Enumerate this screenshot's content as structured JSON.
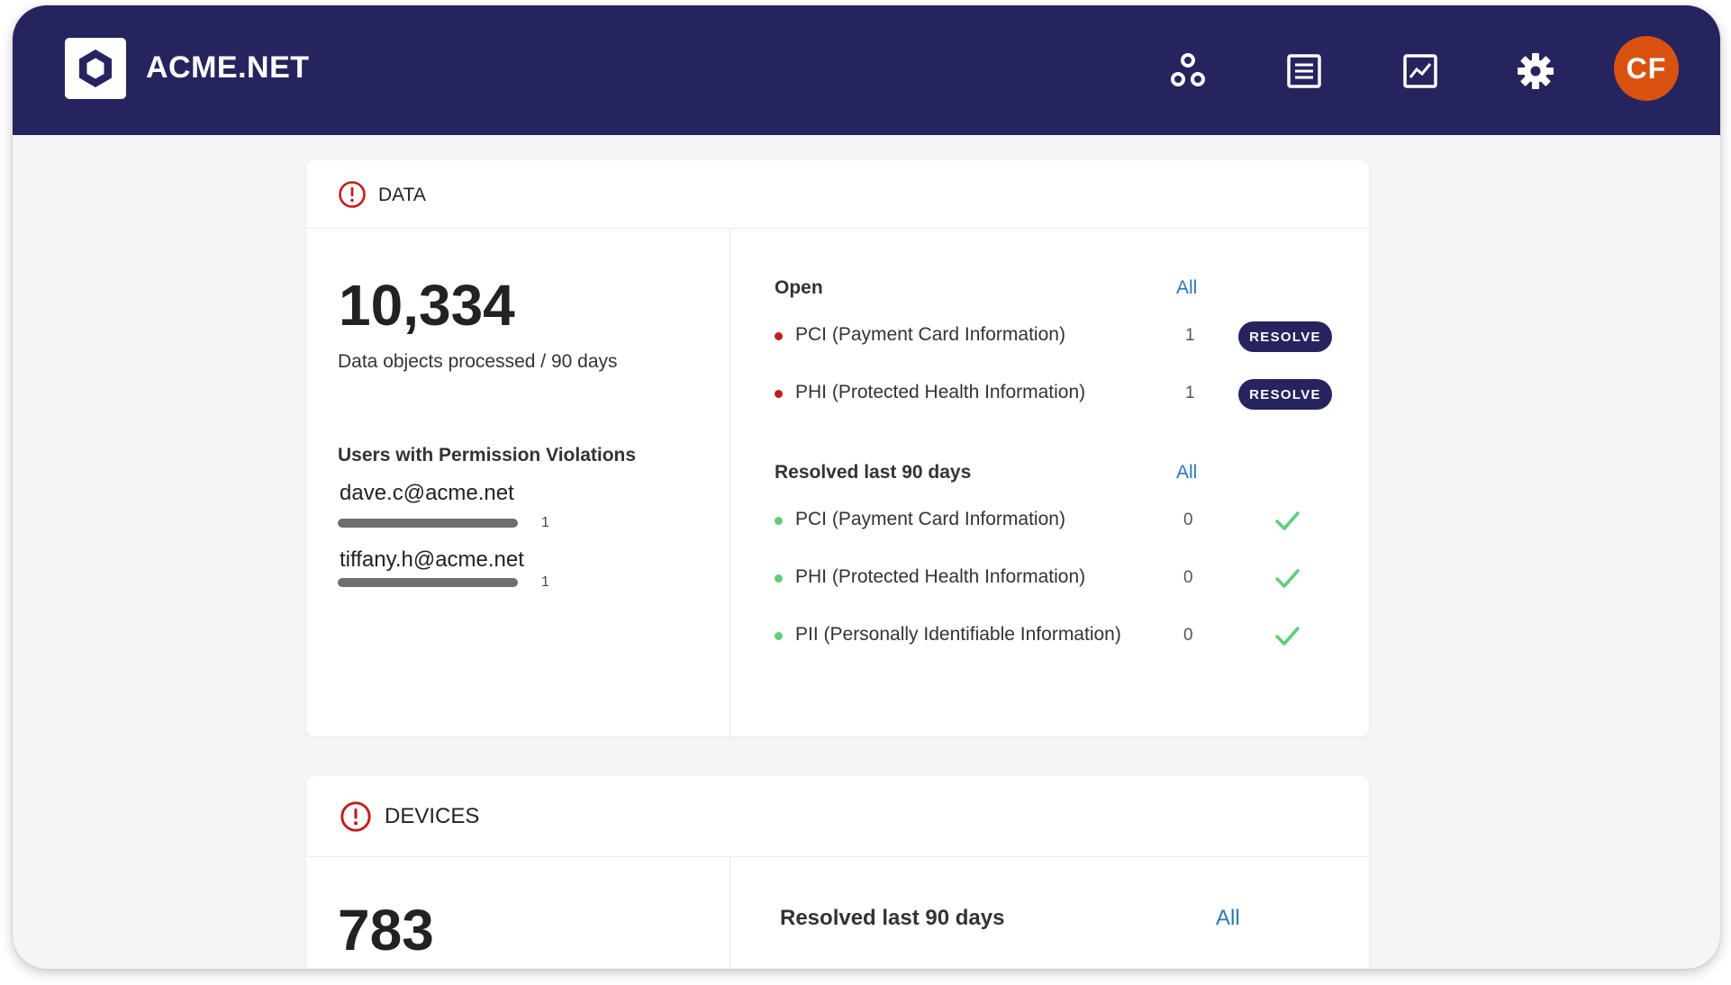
{
  "header": {
    "brand": "ACME.NET",
    "icons": [
      "network-icon",
      "list-icon",
      "chart-icon",
      "gear-icon"
    ],
    "avatar_initials": "CF",
    "colors": {
      "bar": "#25245e",
      "avatar": "#d9520f"
    }
  },
  "data_card": {
    "title": "DATA",
    "big_number": "10,334",
    "big_label": "Data objects processed / 90 days",
    "users_title": "Users with Permission Violations",
    "users": [
      {
        "email": "dave.c@acme.net",
        "count": "1"
      },
      {
        "email": "tiffany.h@acme.net",
        "count": "1"
      }
    ],
    "open": {
      "title": "Open",
      "all_label": "All",
      "items": [
        {
          "label": "PCI (Payment Card Information)",
          "count": "1",
          "action": "RESOLVE"
        },
        {
          "label": "PHI (Protected Health Information)",
          "count": "1",
          "action": "RESOLVE"
        }
      ]
    },
    "resolved": {
      "title": "Resolved last 90 days",
      "all_label": "All",
      "items": [
        {
          "label": "PCI (Payment Card Information)",
          "count": "0"
        },
        {
          "label": "PHI (Protected Health Information)",
          "count": "0"
        },
        {
          "label": "PII (Personally Identifiable Information)",
          "count": "0"
        }
      ]
    }
  },
  "devices_card": {
    "title": "DEVICES",
    "big_number": "783",
    "resolved_title": "Resolved last 90 days",
    "all_label": "All"
  },
  "status_colors": {
    "open": "#c41b1b",
    "resolved": "#5fce7b",
    "link": "#2a79b5"
  }
}
